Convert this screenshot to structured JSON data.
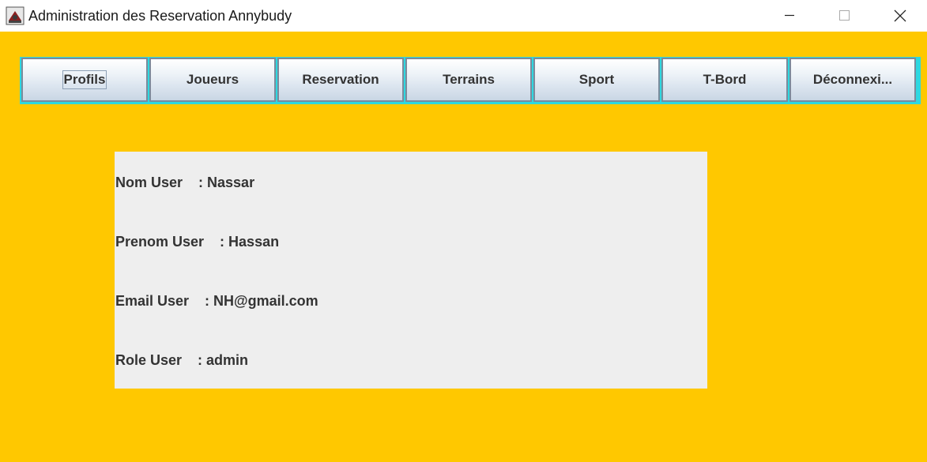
{
  "window": {
    "title": "Administration des Reservation Annybudy",
    "icon": "java-app-icon",
    "controls": {
      "minimize": "minimize-icon",
      "maximize": "maximize-icon",
      "close": "close-icon"
    }
  },
  "menu": {
    "items": [
      {
        "label": "Profils",
        "focused": true
      },
      {
        "label": "Joueurs"
      },
      {
        "label": "Reservation"
      },
      {
        "label": "Terrains"
      },
      {
        "label": "Sport"
      },
      {
        "label": "T-Bord"
      },
      {
        "label": "Déconnexi..."
      }
    ]
  },
  "profile": {
    "nom": "Nom User    : Nassar",
    "prenom": "Prenom User    : Hassan",
    "email": "Email User    : NH@gmail.com",
    "role": "Role User    : admin"
  },
  "colors": {
    "background": "#ffc800",
    "panel": "#eeeeee",
    "menu_accent": "#2ed8e0",
    "text": "#333333"
  }
}
